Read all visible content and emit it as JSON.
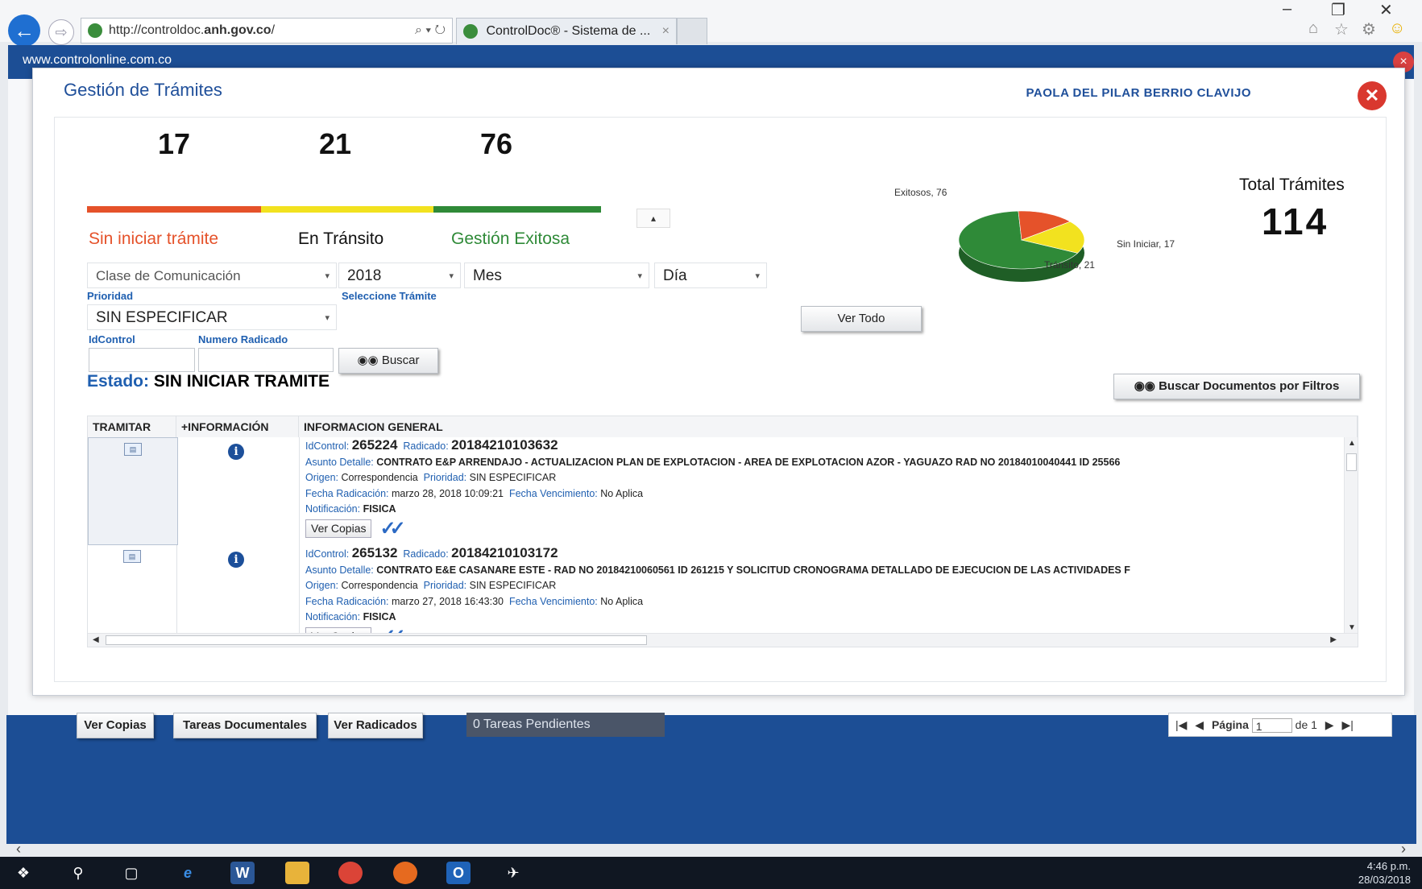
{
  "browser": {
    "url_prefix": "http://controldoc.",
    "url_domain": "anh.gov.co",
    "url_suffix": "/",
    "tab_title": "ControlDoc® - Sistema de ...",
    "tab_close": "×",
    "search_glyph": "⌕ ▾ ↻",
    "min": "–",
    "restore": "❐",
    "close": "✕"
  },
  "site": {
    "label": "www.controlonline.com.co",
    "close": "×"
  },
  "modal": {
    "title": "Gestión de Trámites",
    "user": "PAOLA DEL PILAR BERRIO CLAVIJO",
    "close": "✕"
  },
  "summary": {
    "sin_iniciar": {
      "count": "17",
      "label": "Sin iniciar trámite",
      "color": "#e5522a"
    },
    "en_transito": {
      "count": "21",
      "label": "En Tránsito",
      "color": "#f2e21f"
    },
    "exitosa": {
      "count": "76",
      "label": "Gestión Exitosa",
      "color": "#2f8a38"
    },
    "expander": "▴",
    "total_label": "Total Trámites",
    "total_value": "114"
  },
  "chart_data": {
    "type": "pie",
    "series": [
      {
        "name": "Exitosos",
        "value": 76,
        "color": "#2f8a38",
        "label": "Exitosos, 76"
      },
      {
        "name": "Sin Iniciar",
        "value": 17,
        "color": "#e5522a",
        "label": "Sin Iniciar, 17"
      },
      {
        "name": "Tránsito",
        "value": 21,
        "color": "#f2e21f",
        "label": "Tránsito, 21"
      }
    ]
  },
  "filters": {
    "clase": "Clase de Comunicación",
    "year": "2018",
    "mes": "Mes",
    "dia": "Día",
    "prioridad_label": "Prioridad",
    "prioridad_value": "SIN ESPECIFICAR",
    "seleccione_tramite": "Seleccione Trámite",
    "idcontrol_label": "IdControl",
    "radicado_label": "Numero Radicado",
    "idcontrol_value": "",
    "radicado_value": "",
    "buscar": "Buscar",
    "ver_todo": "Ver Todo",
    "buscar_filtros": "Buscar Documentos por Filtros",
    "caret": "▾"
  },
  "estado": {
    "label": "Estado:",
    "value": "SIN INICIAR TRAMITE"
  },
  "grid": {
    "headers": [
      "TRAMITAR",
      "+INFORMACIÓN",
      "INFORMACION GENERAL"
    ],
    "keys": {
      "idcontrol": "IdControl:",
      "radicado": "Radicado:",
      "asunto": "Asunto Detalle:",
      "origen": "Origen:",
      "prioridad": "Prioridad:",
      "fecha_rad": "Fecha Radicación:",
      "fecha_venc": "Fecha Vencimiento:",
      "notificacion": "Notificación:"
    },
    "rows": [
      {
        "idcontrol": "265224",
        "radicado": "20184210103632",
        "asunto": "CONTRATO E&P ARRENDAJO - ACTUALIZACION PLAN DE EXPLOTACION - AREA DE EXPLOTACION AZOR - YAGUAZO RAD NO 20184010040441 ID 25566",
        "origen": "Correspondencia",
        "prioridad": "SIN ESPECIFICAR",
        "fecha_rad": "marzo 28, 2018 10:09:21",
        "fecha_venc": "No Aplica",
        "notificacion": "FISICA",
        "ver_copias": "Ver Copias"
      },
      {
        "idcontrol": "265132",
        "radicado": "20184210103172",
        "asunto": "CONTRATO E&E CASANARE ESTE - RAD NO 20184210060561 ID 261215 Y SOLICITUD CRONOGRAMA DETALLADO DE EJECUCION DE LAS ACTIVIDADES F",
        "origen": "Correspondencia",
        "prioridad": "SIN ESPECIFICAR",
        "fecha_rad": "marzo 27, 2018 16:43:30",
        "fecha_venc": "No Aplica",
        "notificacion": "FISICA",
        "ver_copias": "Ver Copias"
      }
    ]
  },
  "footer": {
    "ver_copias": "Ver Copias",
    "tareas_doc": "Tareas Documentales",
    "ver_radicados": "Ver Radicados",
    "pendientes": "0 Tareas Pendientes",
    "pagina_label": "Página",
    "pagina_value": "1",
    "de": "de 1"
  },
  "taskbar": {
    "time": "4:46 p.m.",
    "date": "28/03/2018"
  }
}
